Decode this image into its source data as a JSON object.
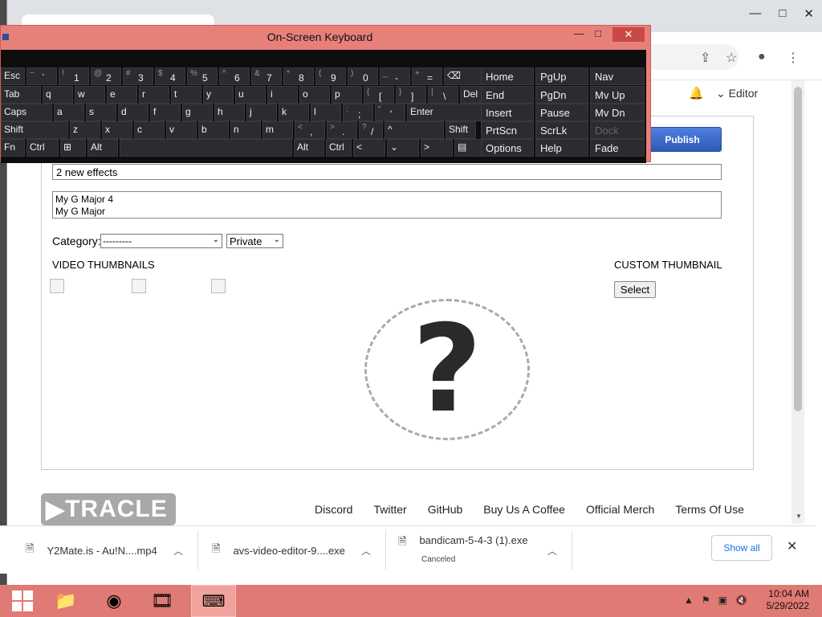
{
  "browser": {
    "window_controls": [
      "—",
      "□",
      "✕"
    ],
    "header": {
      "editor_label": "Editor"
    }
  },
  "editor": {
    "publish_label": "Publish",
    "title_value": "2 new effects",
    "description_value": "My G Major 4\nMy G Major",
    "category_label": "Category:",
    "category_selected": "---------",
    "privacy_selected": "Private",
    "video_thumbnails_label": "VIDEO THUMBNAILS",
    "custom_thumbnail_label": "CUSTOM THUMBNAIL",
    "select_label": "Select",
    "placeholder_mark": "?"
  },
  "footer": {
    "logo": "TRACLE",
    "links": [
      "Discord",
      "Twitter",
      "GitHub",
      "Buy Us A Coffee",
      "Official Merch",
      "Terms Of Use"
    ]
  },
  "downloads": {
    "items": [
      {
        "name": "Y2Mate.is - Au!N....mp4",
        "status": ""
      },
      {
        "name": "avs-video-editor-9....exe",
        "status": ""
      },
      {
        "name": "bandicam-5-4-3 (1).exe",
        "status": "Canceled"
      }
    ],
    "show_all": "Show all"
  },
  "keyboard": {
    "title": "On-Screen Keyboard",
    "rows": [
      [
        {
          "t": "",
          "b": "Esc"
        },
        {
          "t": "~",
          "b": "`"
        },
        {
          "t": "!",
          "b": "1"
        },
        {
          "t": "@",
          "b": "2"
        },
        {
          "t": "#",
          "b": "3"
        },
        {
          "t": "$",
          "b": "4"
        },
        {
          "t": "%",
          "b": "5"
        },
        {
          "t": "^",
          "b": "6"
        },
        {
          "t": "&",
          "b": "7"
        },
        {
          "t": "*",
          "b": "8"
        },
        {
          "t": "(",
          "b": "9"
        },
        {
          "t": ")",
          "b": "0"
        },
        {
          "t": "_",
          "b": "-"
        },
        {
          "t": "+",
          "b": "="
        },
        {
          "t": "",
          "b": "⌫"
        }
      ],
      [
        {
          "t": "",
          "b": "Tab"
        },
        {
          "t": "",
          "b": "q"
        },
        {
          "t": "",
          "b": "w"
        },
        {
          "t": "",
          "b": "e"
        },
        {
          "t": "",
          "b": "r"
        },
        {
          "t": "",
          "b": "t"
        },
        {
          "t": "",
          "b": "y"
        },
        {
          "t": "",
          "b": "u"
        },
        {
          "t": "",
          "b": "i"
        },
        {
          "t": "",
          "b": "o"
        },
        {
          "t": "",
          "b": "p"
        },
        {
          "t": "{",
          "b": "["
        },
        {
          "t": "}",
          "b": "]"
        },
        {
          "t": "|",
          "b": "\\"
        },
        {
          "t": "",
          "b": "Del"
        }
      ],
      [
        {
          "t": "",
          "b": "Caps"
        },
        {
          "t": "",
          "b": "a"
        },
        {
          "t": "",
          "b": "s"
        },
        {
          "t": "",
          "b": "d"
        },
        {
          "t": "",
          "b": "f"
        },
        {
          "t": "",
          "b": "g"
        },
        {
          "t": "",
          "b": "h"
        },
        {
          "t": "",
          "b": "j"
        },
        {
          "t": "",
          "b": "k"
        },
        {
          "t": "",
          "b": "l"
        },
        {
          "t": ":",
          "b": ";"
        },
        {
          "t": "\"",
          "b": "'"
        },
        {
          "t": "",
          "b": "Enter"
        }
      ],
      [
        {
          "t": "",
          "b": "Shift"
        },
        {
          "t": "",
          "b": "z"
        },
        {
          "t": "",
          "b": "x"
        },
        {
          "t": "",
          "b": "c"
        },
        {
          "t": "",
          "b": "v"
        },
        {
          "t": "",
          "b": "b"
        },
        {
          "t": "",
          "b": "n"
        },
        {
          "t": "",
          "b": "m"
        },
        {
          "t": "<",
          "b": ","
        },
        {
          "t": ">",
          "b": "."
        },
        {
          "t": "?",
          "b": "/"
        },
        {
          "t": "",
          "b": "^"
        },
        {
          "t": "",
          "b": "Shift"
        }
      ],
      [
        {
          "t": "",
          "b": "Fn"
        },
        {
          "t": "",
          "b": "Ctrl"
        },
        {
          "t": "",
          "b": "⊞"
        },
        {
          "t": "",
          "b": "Alt"
        },
        {
          "t": "",
          "b": ""
        },
        {
          "t": "",
          "b": "Alt"
        },
        {
          "t": "",
          "b": "Ctrl"
        },
        {
          "t": "",
          "b": "<"
        },
        {
          "t": "",
          "b": "⌄"
        },
        {
          "t": "",
          "b": ">"
        },
        {
          "t": "",
          "b": "▤"
        }
      ]
    ],
    "nav_keys": [
      [
        "Home",
        "PgUp",
        "Nav"
      ],
      [
        "End",
        "PgDn",
        "Mv Up"
      ],
      [
        "Insert",
        "Pause",
        "Mv Dn"
      ],
      [
        "PrtScn",
        "ScrLk",
        "Dock"
      ],
      [
        "Options",
        "Help",
        "Fade"
      ]
    ]
  },
  "taskbar": {
    "time": "10:04 AM",
    "date": "5/29/2022"
  }
}
